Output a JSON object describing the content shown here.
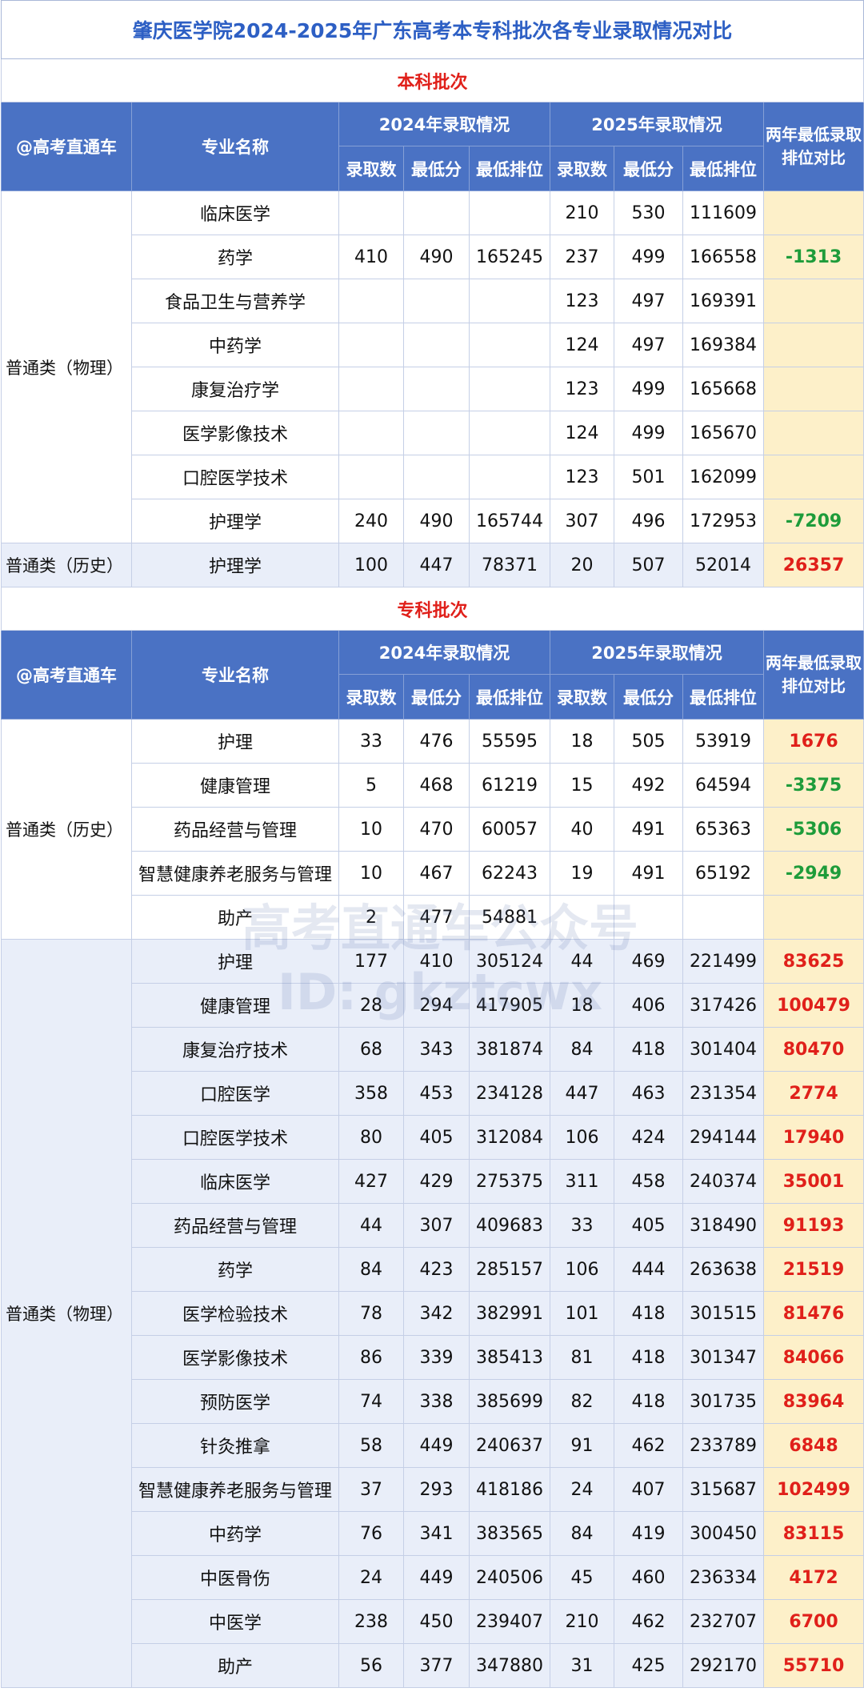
{
  "title": "肇庆医学院2024-2025年广东高考本专科批次各专业录取情况对比",
  "colors": {
    "header_bg": "#4a72c4",
    "title_text": "#2d5fc4",
    "batch_text": "#e0201a",
    "positive": "#e0201a",
    "negative": "#1e9c3a",
    "compare_bg": "#fdf0c9",
    "alt_row_bg": "#e9eef9"
  },
  "header": {
    "account": "@高考直通车",
    "major": "专业名称",
    "year2024": "2024年录取情况",
    "year2025": "2025年录取情况",
    "compare": "两年最低录取排位对比",
    "sub": [
      "录取数",
      "最低分",
      "最低排位",
      "录取数",
      "最低分",
      "最低排位"
    ]
  },
  "benke": {
    "label": "本科批次",
    "groups": [
      {
        "category": "普通类（物理）",
        "rows": [
          [
            "临床医学",
            "",
            "",
            "",
            "210",
            "530",
            "111609",
            ""
          ],
          [
            "药学",
            "410",
            "490",
            "165245",
            "237",
            "499",
            "166558",
            "-1313"
          ],
          [
            "食品卫生与营养学",
            "",
            "",
            "",
            "123",
            "497",
            "169391",
            ""
          ],
          [
            "中药学",
            "",
            "",
            "",
            "124",
            "497",
            "169384",
            ""
          ],
          [
            "康复治疗学",
            "",
            "",
            "",
            "123",
            "499",
            "165668",
            ""
          ],
          [
            "医学影像技术",
            "",
            "",
            "",
            "124",
            "499",
            "165670",
            ""
          ],
          [
            "口腔医学技术",
            "",
            "",
            "",
            "123",
            "501",
            "162099",
            ""
          ],
          [
            "护理学",
            "240",
            "490",
            "165744",
            "307",
            "496",
            "172953",
            "-7209"
          ]
        ]
      },
      {
        "category": "普通类（历史）",
        "rows": [
          [
            "护理学",
            "100",
            "447",
            "78371",
            "20",
            "507",
            "52014",
            "26357"
          ]
        ]
      }
    ]
  },
  "zhuanke": {
    "label": "专科批次",
    "groups": [
      {
        "category": "普通类（历史）",
        "rows": [
          [
            "护理",
            "33",
            "476",
            "55595",
            "18",
            "505",
            "53919",
            "1676"
          ],
          [
            "健康管理",
            "5",
            "468",
            "61219",
            "15",
            "492",
            "64594",
            "-3375"
          ],
          [
            "药品经营与管理",
            "10",
            "470",
            "60057",
            "40",
            "491",
            "65363",
            "-5306"
          ],
          [
            "智慧健康养老服务与管理",
            "10",
            "467",
            "62243",
            "19",
            "491",
            "65192",
            "-2949"
          ],
          [
            "助产",
            "2",
            "477",
            "54881",
            "",
            "",
            "",
            ""
          ]
        ]
      },
      {
        "category": "普通类（物理）",
        "rows": [
          [
            "护理",
            "177",
            "410",
            "305124",
            "44",
            "469",
            "221499",
            "83625"
          ],
          [
            "健康管理",
            "28",
            "294",
            "417905",
            "18",
            "406",
            "317426",
            "100479"
          ],
          [
            "康复治疗技术",
            "68",
            "343",
            "381874",
            "84",
            "418",
            "301404",
            "80470"
          ],
          [
            "口腔医学",
            "358",
            "453",
            "234128",
            "447",
            "463",
            "231354",
            "2774"
          ],
          [
            "口腔医学技术",
            "80",
            "405",
            "312084",
            "106",
            "424",
            "294144",
            "17940"
          ],
          [
            "临床医学",
            "427",
            "429",
            "275375",
            "311",
            "458",
            "240374",
            "35001"
          ],
          [
            "药品经营与管理",
            "44",
            "307",
            "409683",
            "33",
            "405",
            "318490",
            "91193"
          ],
          [
            "药学",
            "84",
            "423",
            "285157",
            "106",
            "444",
            "263638",
            "21519"
          ],
          [
            "医学检验技术",
            "78",
            "342",
            "382991",
            "101",
            "418",
            "301515",
            "81476"
          ],
          [
            "医学影像技术",
            "86",
            "339",
            "385413",
            "81",
            "418",
            "301347",
            "84066"
          ],
          [
            "预防医学",
            "74",
            "338",
            "385699",
            "82",
            "418",
            "301735",
            "83964"
          ],
          [
            "针灸推拿",
            "58",
            "449",
            "240637",
            "91",
            "462",
            "233789",
            "6848"
          ],
          [
            "智慧健康养老服务与管理",
            "37",
            "293",
            "418186",
            "24",
            "407",
            "315687",
            "102499"
          ],
          [
            "中药学",
            "76",
            "341",
            "383565",
            "84",
            "419",
            "300450",
            "83115"
          ],
          [
            "中医骨伤",
            "24",
            "449",
            "240506",
            "45",
            "460",
            "236334",
            "4172"
          ],
          [
            "中医学",
            "238",
            "450",
            "239407",
            "210",
            "462",
            "232707",
            "6700"
          ],
          [
            "助产",
            "56",
            "377",
            "347880",
            "31",
            "425",
            "292170",
            "55710"
          ]
        ]
      }
    ]
  },
  "watermark": {
    "line1": "高考直通车公众号",
    "line2": "ID: gkztcwx"
  }
}
